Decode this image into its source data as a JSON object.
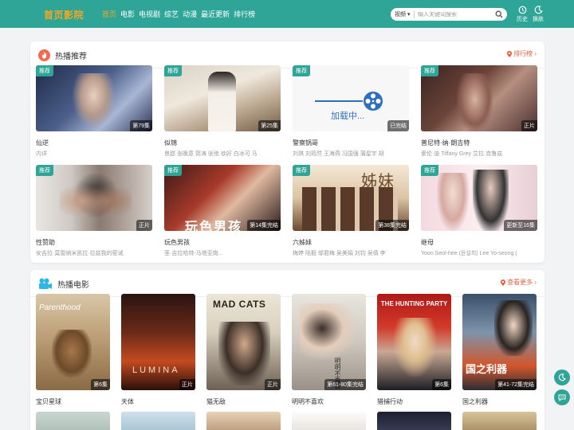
{
  "header": {
    "logo": "首页影院",
    "nav": [
      "首页",
      "电影",
      "电视剧",
      "综艺",
      "动漫",
      "最近更新",
      "排行榜"
    ],
    "search_type": "视频",
    "search_placeholder": "输入关键词搜索",
    "history_label": "历史",
    "theme_label": "换肤",
    "colors": {
      "primary": "#2fa597",
      "accent": "#f5a623",
      "link": "#e4633e"
    }
  },
  "hot": {
    "title": "热播推荐",
    "more": "排行榜",
    "cards": [
      {
        "title": "仙逆",
        "desc": "内详",
        "badge": "推荐",
        "ep": "第79集"
      },
      {
        "title": "似锦",
        "desc": "景甜 张晚意 郭涛 张弛 徐好 白冰可 马",
        "badge": "推荐",
        "ep": "第25集"
      },
      {
        "title": "警察锅哥",
        "desc": "刘琪 刘筠然 王海燕 冯国强 蒲星宇 胡",
        "badge": "推荐",
        "ep": "已完结",
        "loading": "加载中..."
      },
      {
        "title": "普尼特·纳·朗吉特",
        "desc": "爱伦·迪 Tiffany Grey 艾拉·克鲁兹",
        "badge": "推荐",
        "ep": "正片"
      },
      {
        "title": "性赞助",
        "desc": "安吉拉·莫雷纳米凯拉·拉兹我的密诫",
        "badge": "推荐",
        "ep": "正片"
      },
      {
        "title": "玩色男孩",
        "desc": "茎·吉拉哈特-马塔亚南...",
        "badge": "推荐",
        "ep": "第14集完结",
        "poster_text": "玩色男孩"
      },
      {
        "title": "六姊妹",
        "desc": "梅婷 陆毅 邬君梅 吴美娟 刘钧 吴倩 李",
        "badge": "推荐",
        "ep": "第38集完结",
        "poster_text": "姊妹"
      },
      {
        "title": "继母",
        "desc": "Yoon Seol-hee (윤설희) Lee Yo-seong (",
        "badge": "推荐",
        "ep": "更新至16集"
      }
    ]
  },
  "movies": {
    "title": "热播电影",
    "more": "查看更多",
    "cards": [
      {
        "title": "宝贝星球",
        "ep": "第6集",
        "poster_text": "Parenthood"
      },
      {
        "title": "天体",
        "ep": "正片",
        "poster_text": "LUMINA"
      },
      {
        "title": "猫无敌",
        "ep": "正片",
        "poster_text": "MAD CATS"
      },
      {
        "title": "明明不喜欢",
        "ep": "第61-80集完结",
        "poster_text": "明明不喜欢"
      },
      {
        "title": "猎捕行动",
        "ep": "第6集",
        "poster_text": "THE HUNTING PARTY"
      },
      {
        "title": "国之利器",
        "ep": "第41-72集完结",
        "poster_text": "国之利器"
      }
    ]
  }
}
